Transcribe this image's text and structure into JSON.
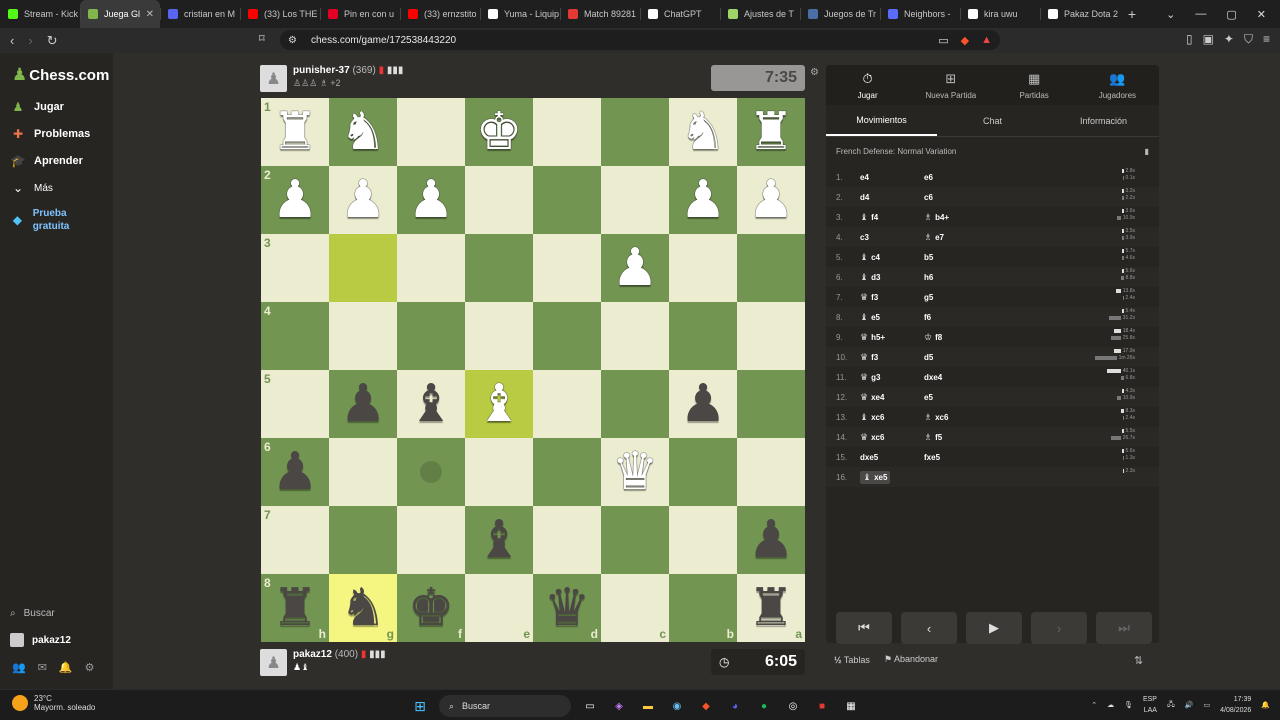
{
  "browser": {
    "tabs": [
      {
        "label": "Stream - Kick",
        "color": "#53fc18"
      },
      {
        "label": "Juega Gl",
        "color": "#81b64c",
        "active": true
      },
      {
        "label": "cristian en M",
        "color": "#5865f2"
      },
      {
        "label": "(33) Los THE",
        "color": "#ff0000"
      },
      {
        "label": "Pin en con u",
        "color": "#e60023"
      },
      {
        "label": "(33) ernzstito",
        "color": "#ff0000"
      },
      {
        "label": "Yuma - Liquip",
        "color": "#ffffff"
      },
      {
        "label": "Match 89281",
        "color": "#e53935"
      },
      {
        "label": "ChatGPT",
        "color": "#ffffff"
      },
      {
        "label": "Ajustes de T",
        "color": "#a0d468"
      },
      {
        "label": "Juegos de Tr",
        "color": "#4a6fa5"
      },
      {
        "label": "Neighbors -",
        "color": "#5a6cff"
      },
      {
        "label": "kira uwu",
        "color": "#ffffff"
      },
      {
        "label": "Pakaz Dota 2",
        "color": "#ffffff"
      }
    ],
    "url": "chess.com/game/172538443220"
  },
  "sidebar": {
    "logo": "Chess.com",
    "items": [
      {
        "label": "Jugar",
        "icon": "play-icon"
      },
      {
        "label": "Problemas",
        "icon": "puzzle-icon"
      },
      {
        "label": "Aprender",
        "icon": "learn-icon"
      },
      {
        "label": "Más",
        "icon": "chevron-down-icon"
      },
      {
        "label": "Prueba gratuita",
        "icon": "diamond-icon"
      }
    ],
    "search": "Buscar",
    "username": "pakaz12"
  },
  "game": {
    "top_player": {
      "name": "punisher-37",
      "rating": "(369)",
      "captured": "+2",
      "clock": "7:35"
    },
    "bottom_player": {
      "name": "pakaz12",
      "rating": "(400)",
      "clock": "6:05"
    },
    "board": [
      [
        "wR",
        "wN",
        "",
        "wK",
        "",
        "",
        "wN",
        "wR"
      ],
      [
        "wP",
        "wP",
        "wP",
        "",
        "",
        "",
        "wP",
        "wP"
      ],
      [
        "",
        "",
        "",
        "",
        "",
        "wP",
        "",
        ""
      ],
      [
        "",
        "",
        "",
        "",
        "",
        "",
        "",
        ""
      ],
      [
        "",
        "bP",
        "bB",
        "wB",
        "",
        "",
        "bP",
        ""
      ],
      [
        "bP",
        "",
        "",
        "",
        "",
        "wQ",
        "",
        ""
      ],
      [
        "",
        "",
        "",
        "bB",
        "",
        "",
        "",
        "bP"
      ],
      [
        "bR",
        "bN",
        "bK",
        "",
        "bQ",
        "",
        "",
        "bR"
      ]
    ],
    "ranks": [
      "1",
      "2",
      "3",
      "4",
      "5",
      "6",
      "7",
      "8"
    ],
    "files": [
      "h",
      "g",
      "f",
      "e",
      "d",
      "c",
      "b",
      "a"
    ],
    "highlights": [
      {
        "r": 2,
        "c": 1
      },
      {
        "r": 4,
        "c": 3
      },
      {
        "r": 7,
        "c": 1
      }
    ],
    "move_dot": {
      "r": 5,
      "c": 2
    }
  },
  "panel": {
    "tabs": [
      {
        "label": "Jugar",
        "icon": "stopwatch-icon",
        "active": true
      },
      {
        "label": "Nueva Partida",
        "icon": "plus-icon"
      },
      {
        "label": "Partidas",
        "icon": "board-icon"
      },
      {
        "label": "Jugadores",
        "icon": "players-icon"
      }
    ],
    "subtabs": [
      "Movimientos",
      "Chat",
      "Información"
    ],
    "opening": "French Defense: Normal Variation",
    "moves": [
      {
        "n": "1.",
        "w": "e4",
        "b": "e6",
        "wt": "2.8s",
        "bt": "0.1s",
        "wbar": 2,
        "bbar": 1
      },
      {
        "n": "2.",
        "w": "d4",
        "b": "c6",
        "wt": "3.2s",
        "bt": "2.2s",
        "wbar": 2,
        "bbar": 2
      },
      {
        "n": "3.",
        "w": "f4",
        "wp": "♝",
        "b": "b4+",
        "bp": "♗",
        "wt": "3.6s",
        "bt": "10.9s",
        "wbar": 2,
        "bbar": 4
      },
      {
        "n": "4.",
        "w": "c3",
        "b": "e7",
        "bp": "♗",
        "wt": "3.5s",
        "bt": "3.9s",
        "wbar": 2,
        "bbar": 2
      },
      {
        "n": "5.",
        "w": "c4",
        "wp": "♝",
        "b": "b5",
        "wt": "5.7s",
        "bt": "4.6s",
        "wbar": 2,
        "bbar": 2
      },
      {
        "n": "6.",
        "w": "d3",
        "wp": "♝",
        "b": "h6",
        "wt": "5.6s",
        "bt": "8.8s",
        "wbar": 2,
        "bbar": 3
      },
      {
        "n": "7.",
        "w": "f3",
        "wp": "♛",
        "b": "g5",
        "wt": "13.8s",
        "bt": "2.4s",
        "wbar": 5,
        "bbar": 1
      },
      {
        "n": "8.",
        "w": "e5",
        "wp": "♝",
        "b": "f6",
        "wt": "5.4s",
        "bt": "31.2s",
        "wbar": 2,
        "bbar": 12
      },
      {
        "n": "9.",
        "w": "h5+",
        "wp": "♛",
        "b": "f8",
        "bp": "♔",
        "wt": "18.4s",
        "bt": "25.8s",
        "wbar": 7,
        "bbar": 10
      },
      {
        "n": "10.",
        "w": "f3",
        "wp": "♛",
        "b": "d5",
        "wt": "17.9s",
        "bt": "1m 26s",
        "wbar": 7,
        "bbar": 22
      },
      {
        "n": "11.",
        "w": "g3",
        "wp": "♛",
        "b": "dxe4",
        "wt": "40.1s",
        "bt": "6.8s",
        "wbar": 14,
        "bbar": 3
      },
      {
        "n": "12.",
        "w": "xe4",
        "wp": "♛",
        "b": "e5",
        "wt": "4.3s",
        "bt": "10.9s",
        "wbar": 2,
        "bbar": 4
      },
      {
        "n": "13.",
        "w": "xc6",
        "wp": "♝",
        "b": "xc6",
        "bp": "♗",
        "wt": "8.3s",
        "bt": "2.4s",
        "wbar": 3,
        "bbar": 1
      },
      {
        "n": "14.",
        "w": "xc6",
        "wp": "♛",
        "b": "f5",
        "bp": "♗",
        "wt": "5.5s",
        "bt": "26.7s",
        "wbar": 2,
        "bbar": 10
      },
      {
        "n": "15.",
        "w": "dxe5",
        "b": "fxe5",
        "wt": "5.6s",
        "bt": "1.3s",
        "wbar": 2,
        "bbar": 1
      },
      {
        "n": "16.",
        "w": "xe5",
        "wp": "♝",
        "b": "",
        "wt": "2.3s",
        "bt": "",
        "wbar": 1,
        "bbar": 0,
        "current": true
      }
    ],
    "actions": {
      "draw": "Tablas",
      "draw_prefix": "½",
      "resign": "Abandonar"
    }
  },
  "taskbar": {
    "temp": "23°C",
    "weather": "Mayorm. soleado",
    "search": "Buscar",
    "lang1": "ESP",
    "lang2": "LAA",
    "time": "17:39",
    "date": "4/08/2026"
  }
}
